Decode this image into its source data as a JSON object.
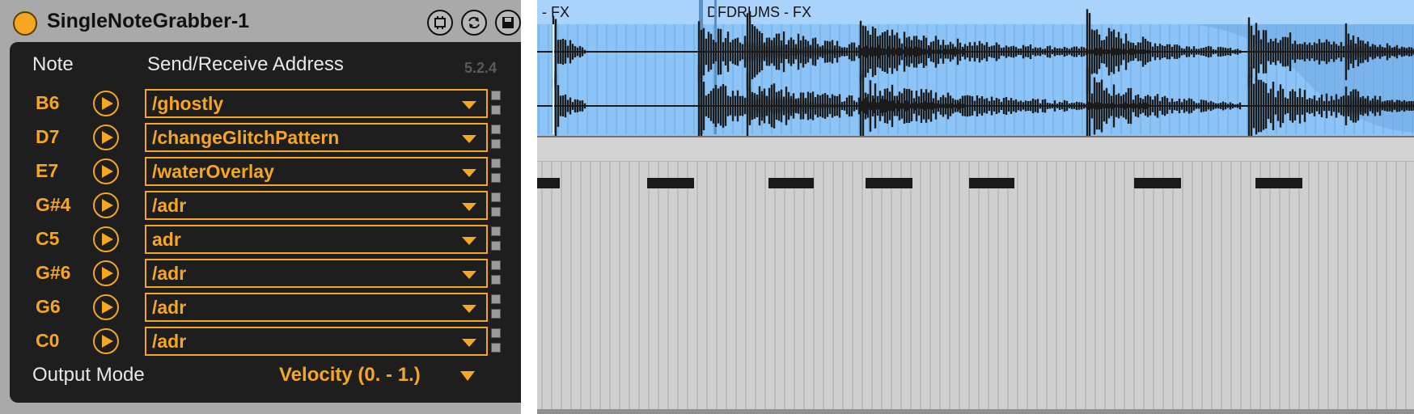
{
  "device": {
    "title": "SingleNoteGrabber-1",
    "version": "5.2.4",
    "header_note": "Note",
    "header_address": "Send/Receive Address",
    "rows": [
      {
        "note": "B6",
        "address": "/ghostly"
      },
      {
        "note": "D7",
        "address": "/changeGlitchPattern"
      },
      {
        "note": "E7",
        "address": "/waterOverlay"
      },
      {
        "note": "G#4",
        "address": "/adr"
      },
      {
        "note": "C5",
        "address": "adr"
      },
      {
        "note": "G#6",
        "address": "/adr"
      },
      {
        "note": "G6",
        "address": "/adr"
      },
      {
        "note": "C0",
        "address": "/adr"
      }
    ],
    "output_mode_label": "Output Mode",
    "output_mode_value": "Velocity (0. - 1.)"
  },
  "arrangement": {
    "clips": [
      {
        "name": "- FX"
      },
      {
        "name": "DF"
      },
      {
        "name": "DRUMS - FX"
      }
    ]
  },
  "colors": {
    "accent": "#f5a623",
    "device_bg": "#1e1e1e",
    "audio_clip": "#8cc4f7",
    "midi_note": "#1a1a1a"
  }
}
